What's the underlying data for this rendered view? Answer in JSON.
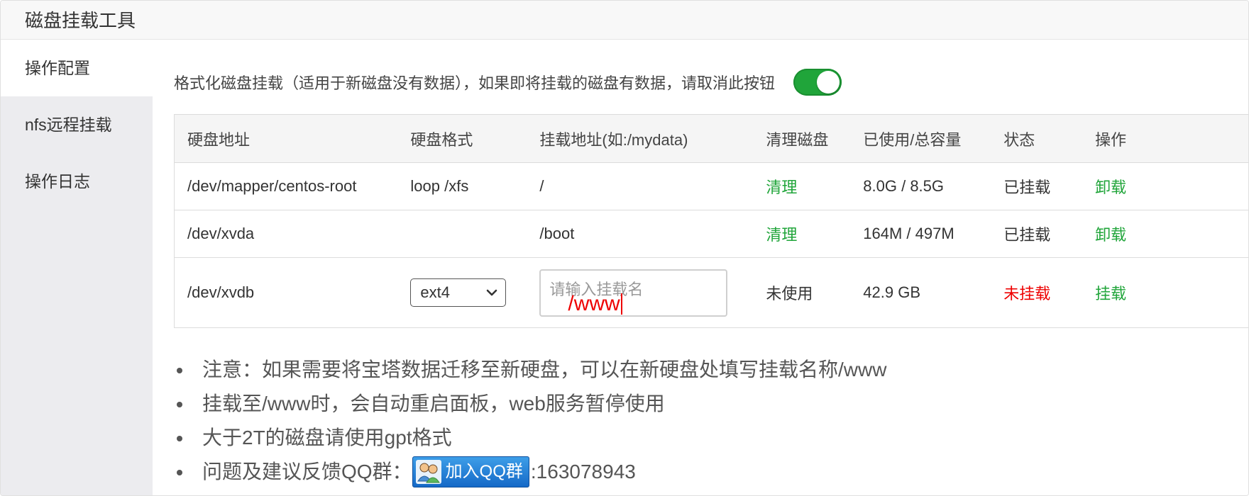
{
  "window": {
    "title": "磁盘挂载工具"
  },
  "sidebar": {
    "items": [
      {
        "label": "操作配置",
        "active": true
      },
      {
        "label": "nfs远程挂载",
        "active": false
      },
      {
        "label": "操作日志",
        "active": false
      }
    ]
  },
  "format_option": {
    "label": "格式化磁盘挂载（适用于新磁盘没有数据），如果即将挂载的磁盘有数据，请取消此按钮",
    "enabled": true
  },
  "table": {
    "columns": [
      "硬盘地址",
      "硬盘格式",
      "挂载地址(如:/mydata)",
      "清理磁盘",
      "已使用/总容量",
      "状态",
      "操作"
    ],
    "rows": [
      {
        "device": "/dev/mapper/centos-root",
        "format": "loop /xfs",
        "mount_point": "/",
        "clean": "清理",
        "usage": "8.0G / 8.5G",
        "status": "已挂载",
        "action": "卸载"
      },
      {
        "device": "/dev/xvda",
        "format": "",
        "mount_point": "/boot",
        "clean": "清理",
        "usage": "164M / 497M",
        "status": "已挂载",
        "action": "卸载"
      },
      {
        "device": "/dev/xvdb",
        "format_select": "ext4",
        "mount_input_placeholder": "请输入挂载名",
        "mount_input_typed": "/www",
        "clean": "未使用",
        "usage": "42.9 GB",
        "status": "未挂载",
        "action": "挂载"
      }
    ]
  },
  "notes": [
    "注意：如果需要将宝塔数据迁移至新硬盘，可以在新硬盘处填写挂载名称/www",
    "挂载至/www时，会自动重启面板，web服务暂停使用",
    "大于2T的磁盘请使用gpt格式"
  ],
  "feedback": {
    "label": "问题及建议反馈QQ群：",
    "button": "加入QQ群",
    "group_number": ":163078943"
  },
  "colors": {
    "accent_green": "#20a53a",
    "warning_red": "#ee0000",
    "sidebar_bg": "#ececef"
  }
}
